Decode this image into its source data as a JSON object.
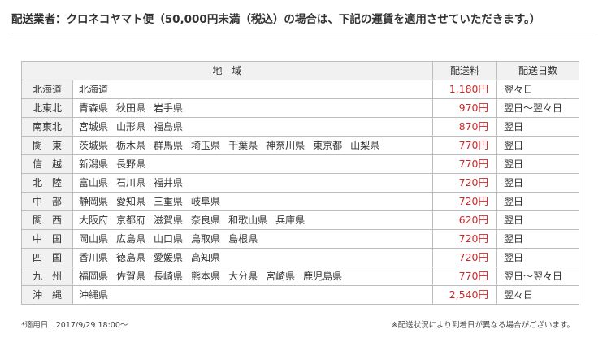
{
  "heading": "配送業者：クロネコヤマト便（50,000円未満（税込）の場合は、下記の運賃を適用させていただきます。）",
  "table": {
    "headers": {
      "area": "地　域",
      "fee": "配送料",
      "days": "配送日数"
    },
    "rows": [
      {
        "region": "北海道",
        "prefectures": [
          "北海道"
        ],
        "fee": "1,180円",
        "days": "翌々日"
      },
      {
        "region": "北東北",
        "prefectures": [
          "青森県",
          "秋田県",
          "岩手県"
        ],
        "fee": "970円",
        "days": "翌日～翌々日"
      },
      {
        "region": "南東北",
        "prefectures": [
          "宮城県",
          "山形県",
          "福島県"
        ],
        "fee": "870円",
        "days": "翌日"
      },
      {
        "region": "関　東",
        "prefectures": [
          "茨城県",
          "栃木県",
          "群馬県",
          "埼玉県",
          "千葉県",
          "神奈川県",
          "東京都",
          "山梨県"
        ],
        "fee": "770円",
        "days": "翌日"
      },
      {
        "region": "信　越",
        "prefectures": [
          "新潟県",
          "長野県"
        ],
        "fee": "770円",
        "days": "翌日"
      },
      {
        "region": "北　陸",
        "prefectures": [
          "富山県",
          "石川県",
          "福井県"
        ],
        "fee": "720円",
        "days": "翌日"
      },
      {
        "region": "中　部",
        "prefectures": [
          "静岡県",
          "愛知県",
          "三重県",
          "岐阜県"
        ],
        "fee": "720円",
        "days": "翌日"
      },
      {
        "region": "関　西",
        "prefectures": [
          "大阪府",
          "京都府",
          "滋賀県",
          "奈良県",
          "和歌山県",
          "兵庫県"
        ],
        "fee": "620円",
        "days": "翌日"
      },
      {
        "region": "中　国",
        "prefectures": [
          "岡山県",
          "広島県",
          "山口県",
          "鳥取県",
          "島根県"
        ],
        "fee": "720円",
        "days": "翌日"
      },
      {
        "region": "四　国",
        "prefectures": [
          "香川県",
          "徳島県",
          "愛媛県",
          "高知県"
        ],
        "fee": "720円",
        "days": "翌日"
      },
      {
        "region": "九　州",
        "prefectures": [
          "福岡県",
          "佐賀県",
          "長崎県",
          "熊本県",
          "大分県",
          "宮崎県",
          "鹿児島県"
        ],
        "fee": "770円",
        "days": "翌日～翌々日"
      },
      {
        "region": "沖　縄",
        "prefectures": [
          "沖縄県"
        ],
        "fee": "2,540円",
        "days": "翌々日"
      }
    ]
  },
  "footnotes": {
    "effective_date": "*適用日：2017/9/29 18:00～",
    "notice": "※配送状況により到着日が異なる場合がございます。"
  },
  "colors": {
    "price_text": "#cc2a2a",
    "header_bg": "#f1f1f1",
    "border": "#bdbdbd"
  }
}
